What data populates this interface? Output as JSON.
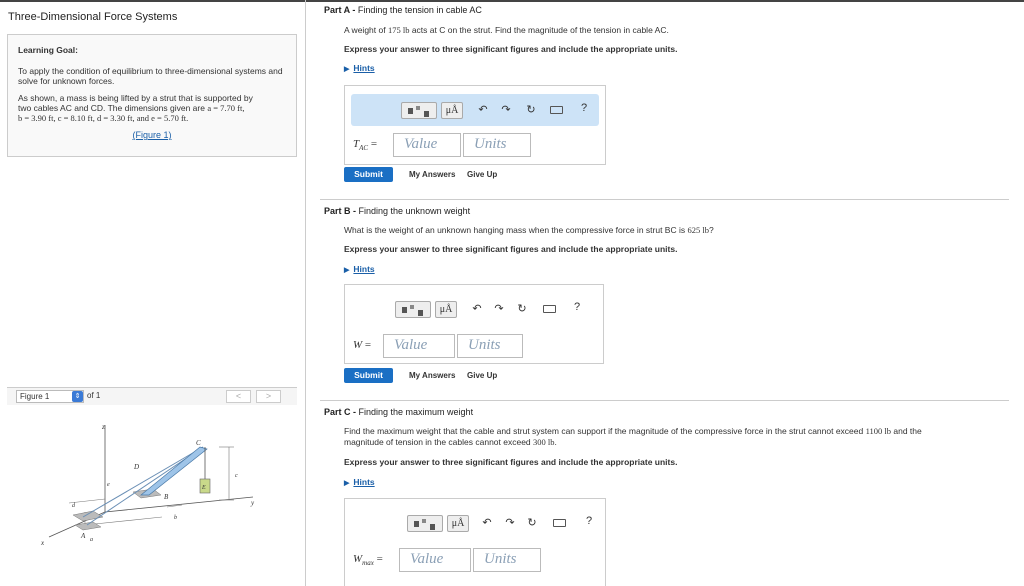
{
  "left": {
    "title": "Three-Dimensional Force Systems",
    "learning_goal_label": "Learning Goal:",
    "goal_text": "To apply the condition of equilibrium to three-dimensional systems and solve for unknown forces.",
    "desc_line1": "As shown, a mass is being lifted by a strut that is supported by",
    "desc_line2_pre": "two cables AC and CD. The dimensions given are ",
    "desc_line2_math": "a = 7.70 ft,",
    "desc_line3_math": "b = 3.90 ft, c = 8.10 ft, d = 3.30 ft, and e = 5.70 ft.",
    "figure_link": "(Figure 1)",
    "figure_select": "Figure 1",
    "figure_of": "of 1",
    "nav_prev": "<",
    "nav_next": ">",
    "figure_labels": {
      "z": "z",
      "C": "C",
      "D": "D",
      "B": "B",
      "E": "E",
      "e": "e",
      "c": "c",
      "d": "d",
      "b": "b",
      "A": "A",
      "a": "a",
      "x": "x",
      "y": "y"
    }
  },
  "toolbar": {
    "mu_label": "μÅ",
    "undo_icon": "undo-icon",
    "redo_icon": "redo-icon",
    "reset_icon": "reset-icon",
    "keyboard_icon": "keyboard-icon",
    "help": "?"
  },
  "parts": [
    {
      "head_bold": "Part A -",
      "head_text": " Finding the tension in cable AC",
      "question_pre": "A weight of ",
      "question_math": "175 lb",
      "question_post": " acts at C on the strut. Find the magnitude of the tension in cable AC.",
      "express": "Express your answer to three significant figures and include the appropriate units.",
      "hints": "Hints",
      "var": "T",
      "var_sub": "AC",
      "eq": " =",
      "value_placeholder": "Value",
      "units_placeholder": "Units",
      "submit": "Submit",
      "my_answers": "My Answers",
      "give_up": "Give Up"
    },
    {
      "head_bold": "Part B -",
      "head_text": " Finding the unknown weight",
      "question_pre": "What is the weight of an unknown hanging mass when the compressive force in strut BC is ",
      "question_math": "625 lb",
      "question_post": "?",
      "express": "Express your answer to three significant figures and include the appropriate units.",
      "hints": "Hints",
      "var": "W",
      "var_sub": "",
      "eq": " =",
      "value_placeholder": "Value",
      "units_placeholder": "Units",
      "submit": "Submit",
      "my_answers": "My Answers",
      "give_up": "Give Up"
    },
    {
      "head_bold": "Part C -",
      "head_text": " Finding the maximum weight",
      "question_line1_pre": "Find the maximum weight that the cable and strut system can support if the magnitude of the compressive force in the strut cannot exceed ",
      "question_line1_math": "1100 lb",
      "question_line1_post": " and the",
      "question_line2_pre": "magnitude of tension in the cables cannot exceed ",
      "question_line2_math": "300 lb",
      "question_line2_post": ".",
      "express": "Express your answer to three significant figures and include the appropriate units.",
      "hints": "Hints",
      "var": "W",
      "var_sub": "max",
      "eq": " =",
      "value_placeholder": "Value",
      "units_placeholder": "Units"
    }
  ]
}
